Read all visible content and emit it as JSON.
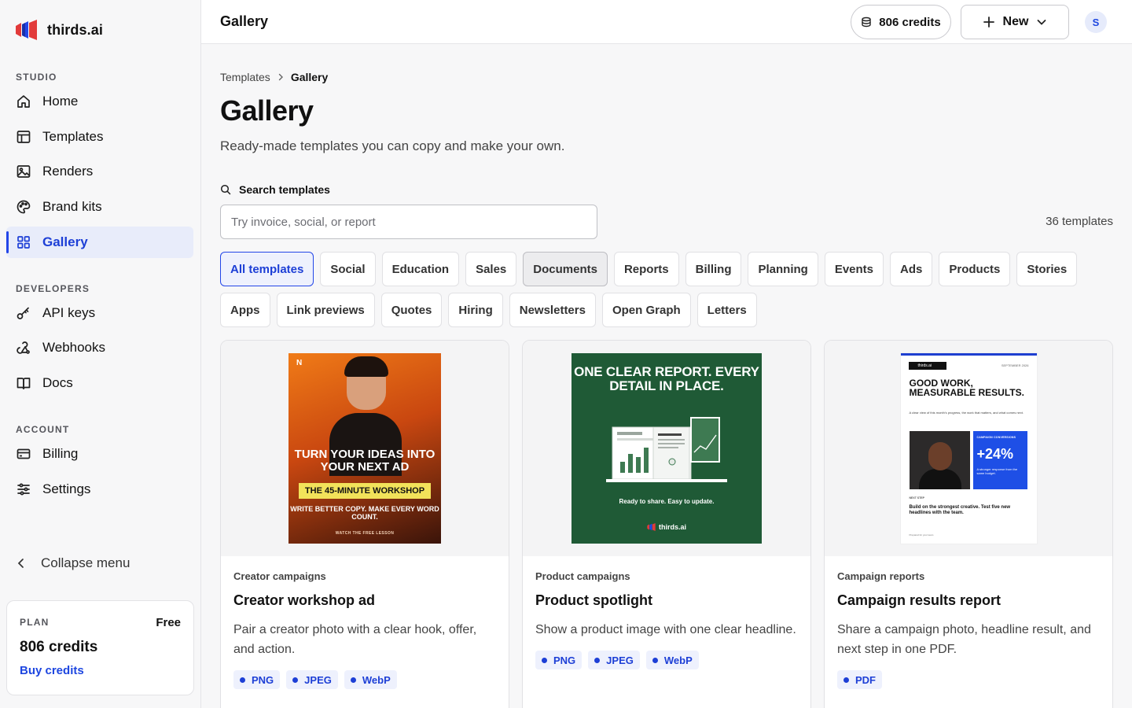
{
  "brand": {
    "name": "thirds.ai"
  },
  "sidebar": {
    "sections": {
      "studio": "STUDIO",
      "developers": "DEVELOPERS",
      "account": "ACCOUNT"
    },
    "items": [
      {
        "label": "Home",
        "icon": "home-icon"
      },
      {
        "label": "Templates",
        "icon": "templates-icon"
      },
      {
        "label": "Renders",
        "icon": "image-icon"
      },
      {
        "label": "Brand kits",
        "icon": "palette-icon"
      },
      {
        "label": "Gallery",
        "icon": "grid-icon",
        "active": true
      },
      {
        "label": "API keys",
        "icon": "key-icon"
      },
      {
        "label": "Webhooks",
        "icon": "webhook-icon"
      },
      {
        "label": "Docs",
        "icon": "book-icon"
      },
      {
        "label": "Billing",
        "icon": "credit-card-icon"
      },
      {
        "label": "Settings",
        "icon": "sliders-icon"
      }
    ],
    "collapse": "Collapse menu",
    "plan": {
      "label": "PLAN",
      "tier": "Free",
      "credits": "806 credits",
      "buy": "Buy credits"
    }
  },
  "header": {
    "title": "Gallery",
    "credits": "806 credits",
    "new_label": "New",
    "avatar_initial": "S"
  },
  "main": {
    "breadcrumb": {
      "parent": "Templates",
      "current": "Gallery"
    },
    "title": "Gallery",
    "subtitle": "Ready-made templates you can copy and make your own.",
    "search": {
      "label": "Search templates",
      "placeholder": "Try invoice, social, or report",
      "value": ""
    },
    "count": "36 templates",
    "filters": [
      "All templates",
      "Social",
      "Education",
      "Sales",
      "Documents",
      "Reports",
      "Billing",
      "Planning",
      "Events",
      "Ads",
      "Products",
      "Stories",
      "Apps",
      "Link previews",
      "Quotes",
      "Hiring",
      "Newsletters",
      "Open Graph",
      "Letters"
    ],
    "active_filter": "All templates",
    "hovered_filter": "Documents",
    "cards": [
      {
        "category": "Creator campaigns",
        "title": "Creator workshop ad",
        "description": "Pair a creator photo with a clear hook, offer, and action.",
        "formats": [
          "PNG",
          "JPEG",
          "WebP"
        ],
        "preview": {
          "badge": "N",
          "headline": "TURN YOUR IDEAS INTO YOUR NEXT AD",
          "band": "THE 45-MINUTE WORKSHOP",
          "sub": "WRITE BETTER COPY. MAKE EVERY WORD COUNT.",
          "footer": "WATCH THE FREE LESSON"
        }
      },
      {
        "category": "Product campaigns",
        "title": "Product spotlight",
        "description": "Show a product image with one clear headline.",
        "formats": [
          "PNG",
          "JPEG",
          "WebP"
        ],
        "preview": {
          "headline": "ONE CLEAR REPORT. EVERY DETAIL IN PLACE.",
          "tagline": "Ready to share. Easy to update.",
          "logo": "thirds.ai"
        }
      },
      {
        "category": "Campaign reports",
        "title": "Campaign results report",
        "description": "Share a campaign photo, headline result, and next step in one PDF.",
        "formats": [
          "PDF"
        ],
        "preview": {
          "logo": "thirds.ai",
          "date": "SEPTEMBER 2026",
          "headline": "GOOD WORK, MEASURABLE RESULTS.",
          "intro": "A clear view of this month's progress, the work that matters, and what comes next.",
          "stat_label": "CAMPAIGN CONVERSIONS",
          "stat_value": "+24%",
          "stat_sub": "A stronger response from the same budget.",
          "next_label": "NEXT STEP",
          "next_text": "Build on the strongest creative. Test five new headlines with the team.",
          "footer": "Prepared for your team"
        }
      }
    ]
  },
  "colors": {
    "accent": "#1d3fd6",
    "active_bg": "#e8ecfa",
    "ad1_orange": "#f07b17",
    "ad2_green": "#1f5a36",
    "ad3_blue": "#1e4fe6"
  }
}
